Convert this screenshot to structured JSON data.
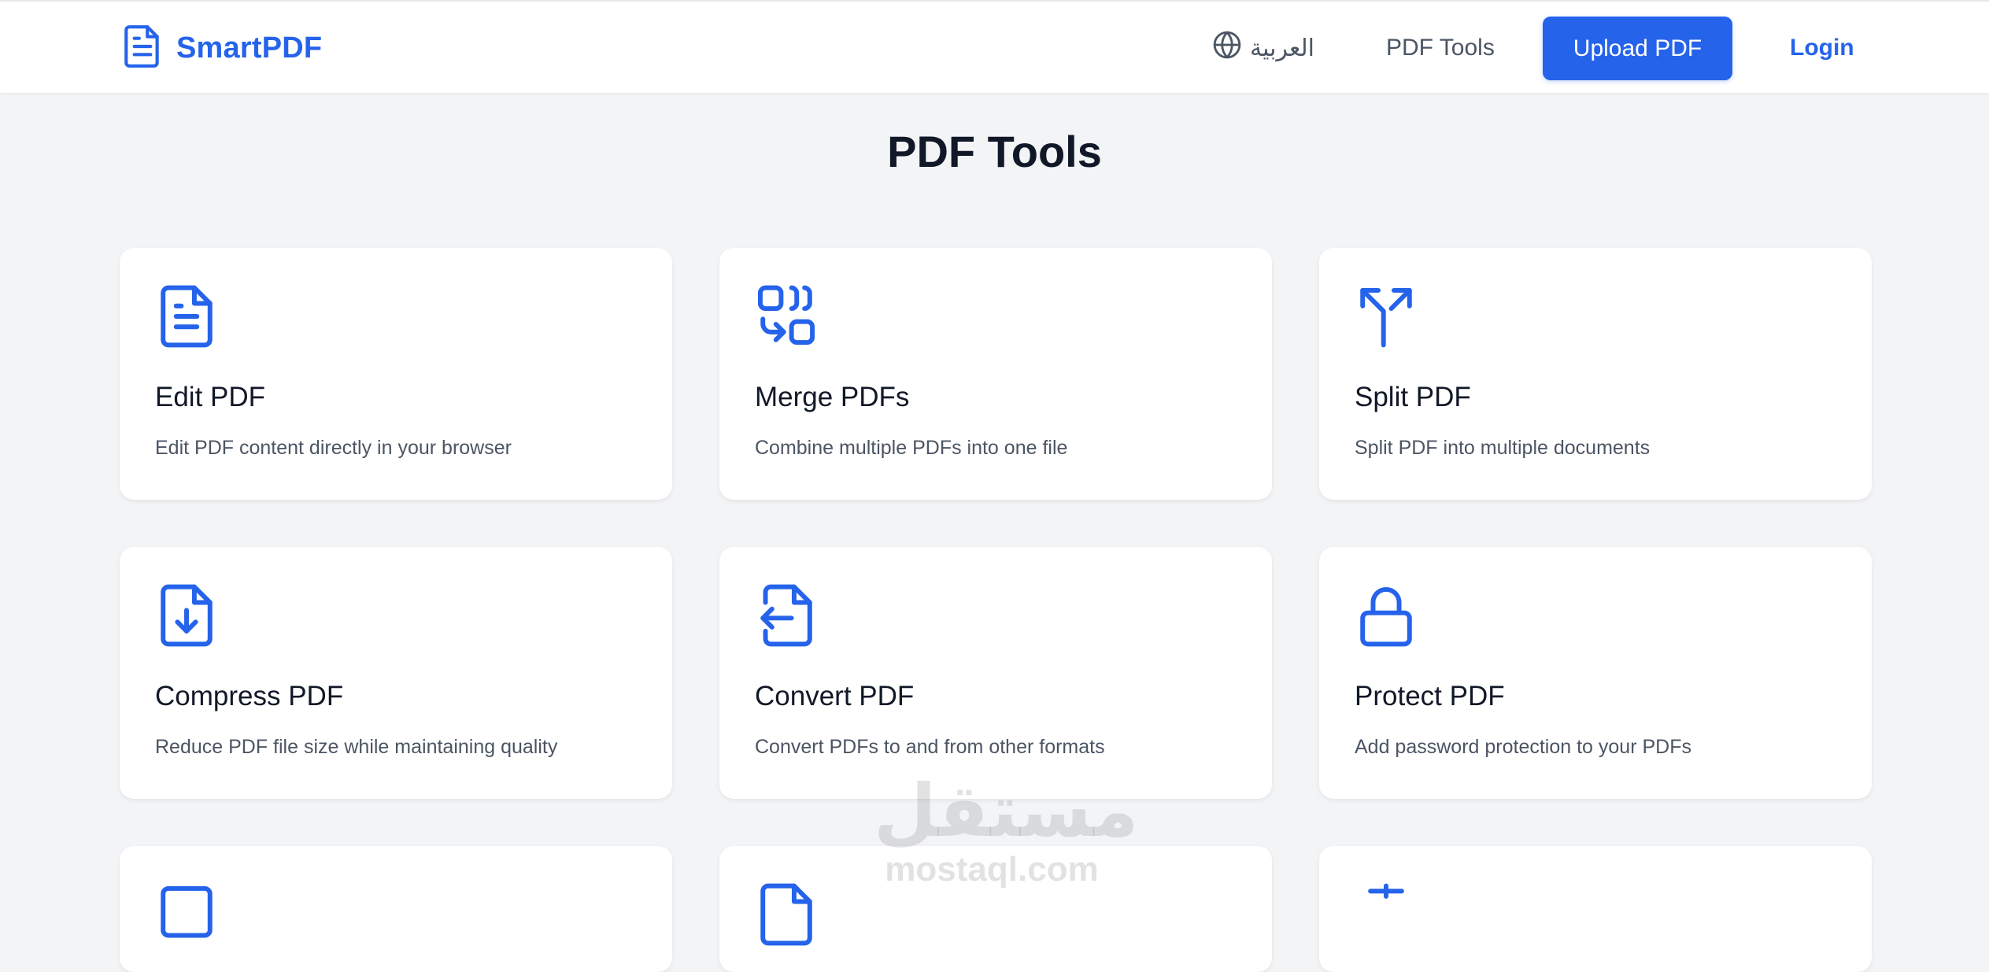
{
  "header": {
    "brand": "SmartPDF",
    "language_label": "العربية",
    "nav_tools_label": "PDF Tools",
    "upload_label": "Upload PDF",
    "login_label": "Login",
    "icons": {
      "brand": "document-icon",
      "language": "globe-icon"
    }
  },
  "main": {
    "title": "PDF Tools",
    "tools": [
      {
        "title": "Edit PDF",
        "description": "Edit PDF content directly in your browser",
        "icon": "file-text-icon"
      },
      {
        "title": "Merge PDFs",
        "description": "Combine multiple PDFs into one file",
        "icon": "merge-icon"
      },
      {
        "title": "Split PDF",
        "description": "Split PDF into multiple documents",
        "icon": "split-icon"
      },
      {
        "title": "Compress PDF",
        "description": "Reduce PDF file size while maintaining quality",
        "icon": "file-download-icon"
      },
      {
        "title": "Convert PDF",
        "description": "Convert PDFs to and from other formats",
        "icon": "file-convert-icon"
      },
      {
        "title": "Protect PDF",
        "description": "Add password protection to your PDFs",
        "icon": "lock-icon"
      }
    ]
  },
  "watermark": {
    "arabic": "مستقل",
    "latin": "mostaql.com"
  },
  "colors": {
    "accent": "#2563eb",
    "background": "#f3f4f6",
    "card": "#ffffff",
    "text": "#111827",
    "muted": "#4b5563"
  }
}
